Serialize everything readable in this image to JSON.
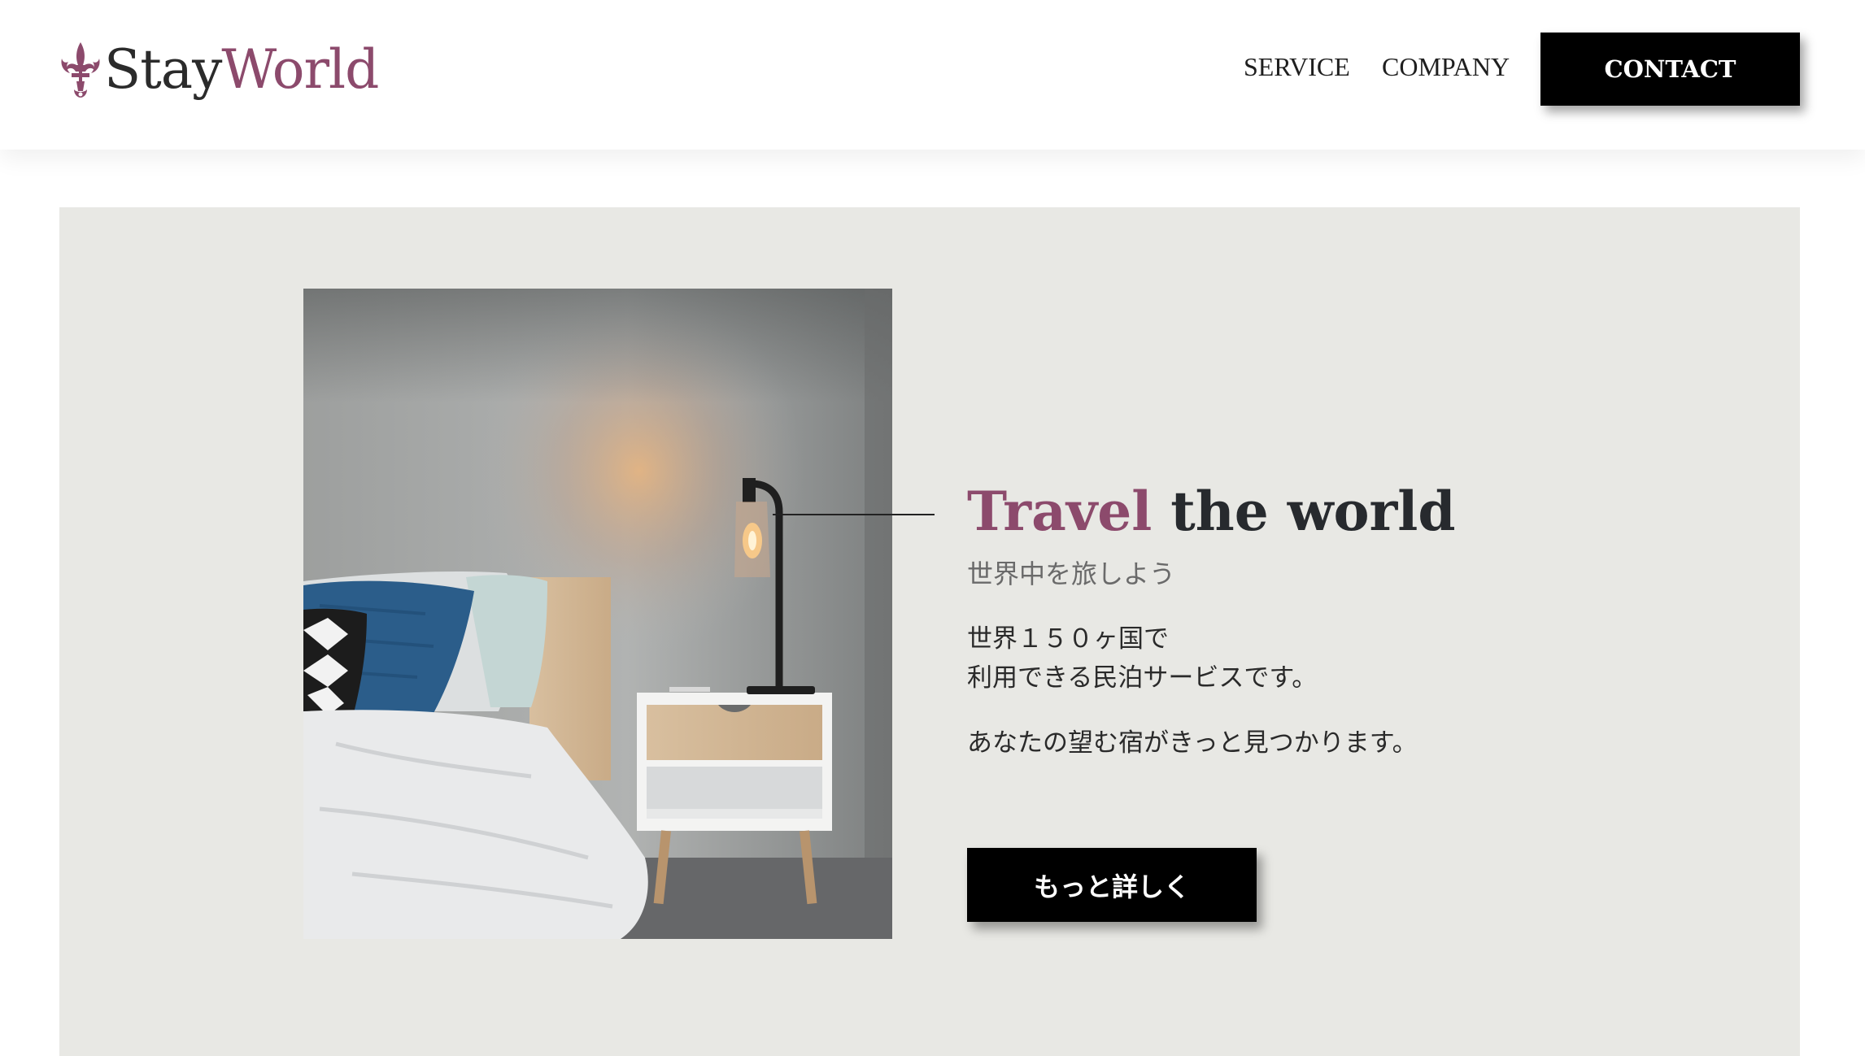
{
  "brand": {
    "name_part1": "Stay",
    "name_part2": "World",
    "accent_color": "#8c4a6c"
  },
  "nav": {
    "items": [
      {
        "label": "SERVICE"
      },
      {
        "label": "COMPANY"
      }
    ],
    "contact_label": "CONTACT"
  },
  "hero": {
    "title_highlight": "Travel",
    "title_rest": "the world",
    "subtitle": "世界中を旅しよう",
    "description_line1": "世界１５０ヶ国で",
    "description_line2": "利用できる民泊サービスです。",
    "description_line3": "あなたの望む宿がきっと見つかります。",
    "button_label": "もっと詳しく",
    "image_icon": "bedroom-photo"
  }
}
